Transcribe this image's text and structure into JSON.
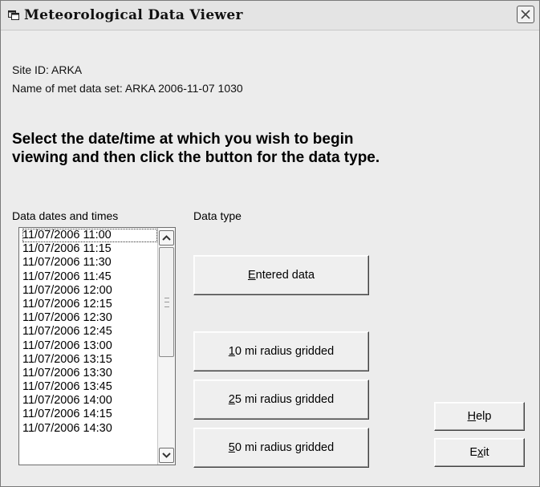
{
  "window": {
    "title": "Meteorological Data Viewer",
    "icon": "window-app-icon",
    "close_icon": "close-icon"
  },
  "info": {
    "site_line": "Site ID:  ARKA",
    "set_line": "Name of met data set: ARKA 2006-11-07 1030"
  },
  "instruction": "Select the date/time at which you wish to begin viewing and then click the button for the data type.",
  "dates": {
    "label": "Data dates and times",
    "selected_index": 0,
    "items": [
      "11/07/2006 11:00",
      "11/07/2006 11:15",
      "11/07/2006 11:30",
      "11/07/2006 11:45",
      "11/07/2006 12:00",
      "11/07/2006 12:15",
      "11/07/2006 12:30",
      "11/07/2006 12:45",
      "11/07/2006 13:00",
      "11/07/2006 13:15",
      "11/07/2006 13:30",
      "11/07/2006 13:45",
      "11/07/2006 14:00",
      "11/07/2006 14:15",
      "11/07/2006 14:30"
    ]
  },
  "data_type": {
    "label": "Data type",
    "entered": {
      "mnemonic": "E",
      "rest": "ntered data"
    },
    "r10": {
      "mnemonic": "1",
      "rest": "0 mi radius gridded"
    },
    "r25": {
      "mnemonic": "2",
      "rest": "5 mi radius gridded"
    },
    "r50": {
      "mnemonic": "5",
      "rest": "0 mi radius gridded"
    }
  },
  "actions": {
    "help": {
      "mnemonic": "H",
      "rest": "elp"
    },
    "exit": {
      "pre": "E",
      "mnemonic": "x",
      "post": "it"
    }
  },
  "colors": {
    "window_bg": "#ececec",
    "titlebar_bg": "#e4e4e4",
    "listbox_bg": "#ffffff"
  }
}
